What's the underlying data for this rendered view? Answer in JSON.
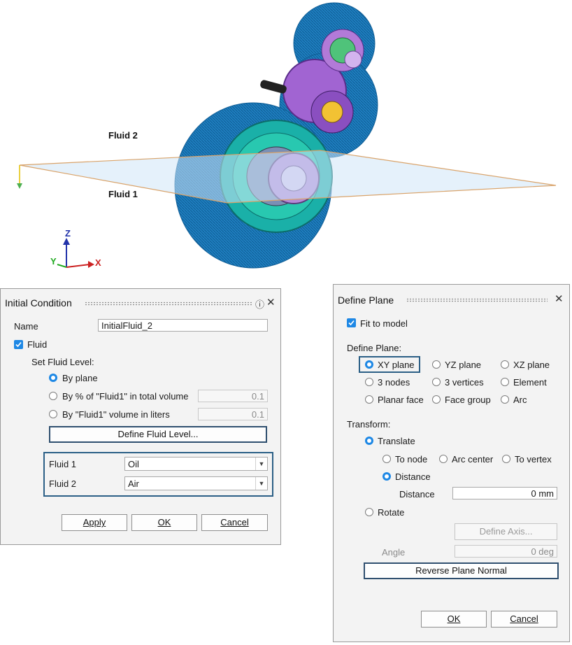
{
  "viewport": {
    "fluid_upper_label": "Fluid 2",
    "fluid_lower_label": "Fluid 1",
    "axis_z": "Z",
    "axis_y": "Y",
    "axis_x": "X"
  },
  "initial_condition": {
    "title": "Initial Condition",
    "name_label": "Name",
    "name_value": "InitialFluid_2",
    "fluid_checkbox_label": "Fluid",
    "set_level_label": "Set Fluid Level:",
    "by_plane_label": "By plane",
    "by_percent_label": "By % of \"Fluid1\" in total volume",
    "by_percent_value": "0.1",
    "by_volume_label": "By \"Fluid1\" volume in liters",
    "by_volume_value": "0.1",
    "define_level_button": "Define Fluid Level...",
    "fluid1_label": "Fluid 1",
    "fluid1_value": "Oil",
    "fluid2_label": "Fluid 2",
    "fluid2_value": "Air",
    "apply_button": "Apply",
    "ok_button": "OK",
    "cancel_button": "Cancel"
  },
  "define_plane": {
    "title": "Define Plane",
    "fit_to_model_label": "Fit to model",
    "define_plane_label": "Define Plane:",
    "options": {
      "xy": "XY plane",
      "yz": "YZ plane",
      "xz": "XZ plane",
      "three_nodes": "3 nodes",
      "three_vertices": "3 vertices",
      "element": "Element",
      "planar_face": "Planar face",
      "face_group": "Face group",
      "arc": "Arc"
    },
    "transform_label": "Transform:",
    "translate_label": "Translate",
    "to_node_label": "To node",
    "arc_center_label": "Arc center",
    "to_vertex_label": "To vertex",
    "distance_option_label": "Distance",
    "distance_field_label": "Distance",
    "distance_value": "0 mm",
    "rotate_label": "Rotate",
    "define_axis_button": "Define Axis...",
    "angle_label": "Angle",
    "angle_value": "0 deg",
    "reverse_normal_button": "Reverse Plane Normal",
    "ok_button": "OK",
    "cancel_button": "Cancel"
  },
  "colors": {
    "accent": "#1e88e5",
    "highlight_border": "#2b5f86",
    "housing_blue": "#1f7fc0",
    "gear_purple": "#9b59d0",
    "gear_teal": "#20b8a8",
    "plane_fill": "#cfe6f7",
    "plane_edge": "#d9a36a"
  },
  "icons": {
    "help": "help-icon",
    "close": "close-icon",
    "dropdown": "chevron-down-icon",
    "check": "check-icon"
  }
}
